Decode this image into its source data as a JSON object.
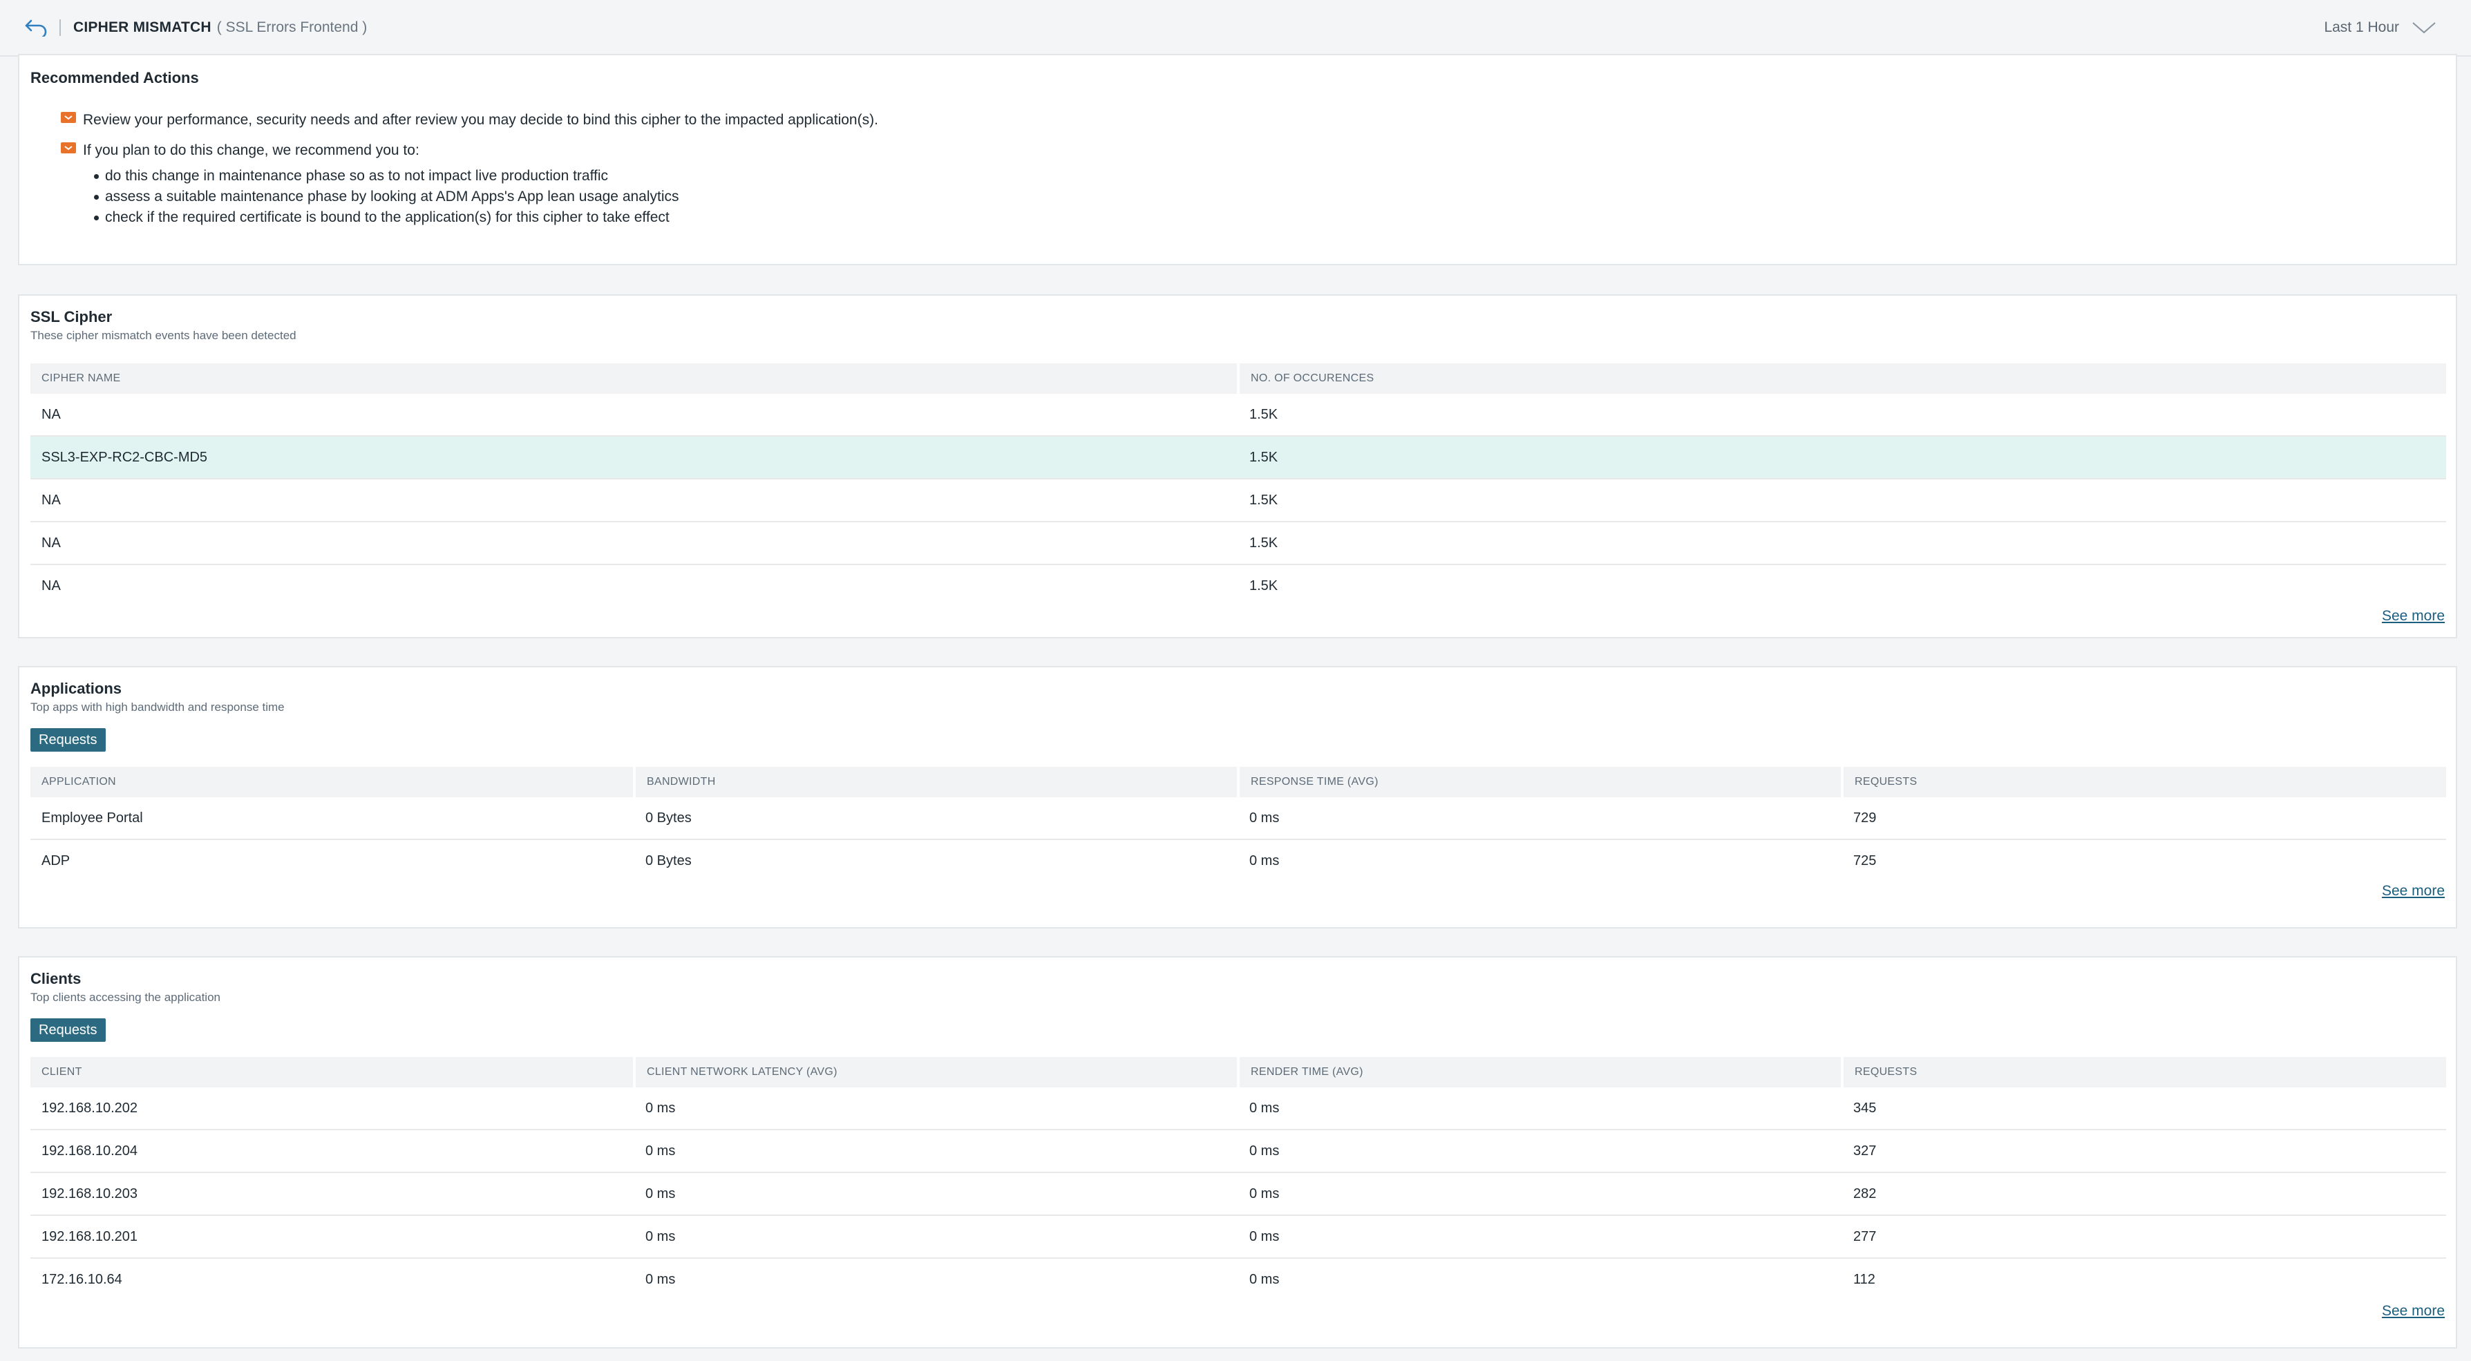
{
  "header": {
    "title": "CIPHER MISMATCH",
    "subtitle": "( SSL Errors Frontend )",
    "time_range": "Last 1 Hour"
  },
  "recommended": {
    "title": "Recommended Actions",
    "items": [
      "Review your performance, security needs and after review you may decide to bind this cipher to the impacted application(s).",
      "If you plan to do this change, we recommend you to:"
    ],
    "bullets": [
      "do this change in maintenance phase so as to not impact live production traffic",
      "assess a suitable maintenance phase by looking at ADM Apps's App lean usage analytics",
      "check if the required certificate is bound to the application(s) for this cipher to take effect"
    ]
  },
  "ssl_cipher": {
    "title": "SSL Cipher",
    "subtitle": "These cipher mismatch events have been detected",
    "columns": [
      "CIPHER NAME",
      "NO. OF OCCURENCES"
    ],
    "rows": [
      [
        "NA",
        "1.5K"
      ],
      [
        "SSL3-EXP-RC2-CBC-MD5",
        "1.5K"
      ],
      [
        "NA",
        "1.5K"
      ],
      [
        "NA",
        "1.5K"
      ],
      [
        "NA",
        "1.5K"
      ]
    ],
    "see_more": "See more"
  },
  "applications": {
    "title": "Applications",
    "subtitle": "Top apps with high bandwidth and response time",
    "tag": "Requests",
    "columns": [
      "APPLICATION",
      "BANDWIDTH",
      "RESPONSE TIME (AVG)",
      "REQUESTS"
    ],
    "rows": [
      [
        "Employee Portal",
        "0 Bytes",
        "0 ms",
        "729"
      ],
      [
        "ADP",
        "0 Bytes",
        "0 ms",
        "725"
      ]
    ],
    "see_more": "See more"
  },
  "clients": {
    "title": "Clients",
    "subtitle": "Top clients accessing the application",
    "tag": "Requests",
    "columns": [
      "CLIENT",
      "CLIENT NETWORK LATENCY (AVG)",
      "RENDER TIME (AVG)",
      "REQUESTS"
    ],
    "rows": [
      [
        "192.168.10.202",
        "0 ms",
        "0 ms",
        "345"
      ],
      [
        "192.168.10.204",
        "0 ms",
        "0 ms",
        "327"
      ],
      [
        "192.168.10.203",
        "0 ms",
        "0 ms",
        "282"
      ],
      [
        "192.168.10.201",
        "0 ms",
        "0 ms",
        "277"
      ],
      [
        "172.16.10.64",
        "0 ms",
        "0 ms",
        "112"
      ]
    ],
    "see_more": "See more"
  },
  "colors": {
    "accent": "#2b6a80",
    "link": "#1a5f80",
    "selected_row": "#e2f4f2",
    "warning_icon": "#e8722a"
  }
}
